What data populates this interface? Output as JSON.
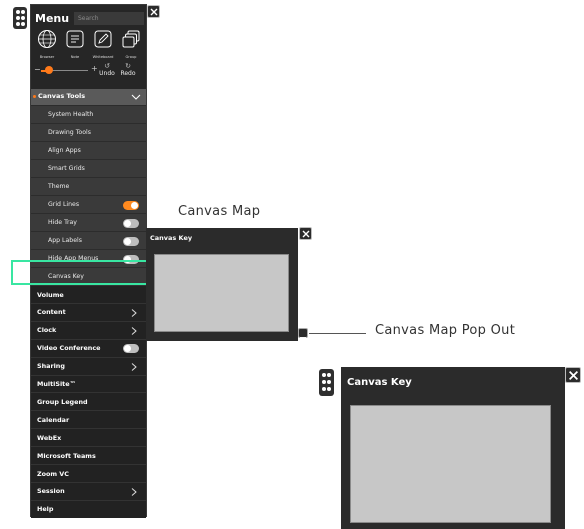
{
  "menu": {
    "title": "Menu",
    "search_placeholder": "Search",
    "tools": [
      {
        "label": "Browser",
        "icon": "globe-icon"
      },
      {
        "label": "Note",
        "icon": "note-icon"
      },
      {
        "label": "Whiteboard",
        "icon": "whiteboard-icon"
      },
      {
        "label": "Group",
        "icon": "group-icon"
      }
    ],
    "zoom": {
      "minus": "−",
      "plus": "+",
      "level": 0.18
    },
    "undo_label": "Undo",
    "redo_label": "Redo",
    "section": {
      "label": "Canvas Tools",
      "expanded": true
    },
    "sub_items": [
      {
        "label": "System Health"
      },
      {
        "label": "Drawing Tools"
      },
      {
        "label": "Align Apps"
      },
      {
        "label": "Smart Grids"
      },
      {
        "label": "Theme"
      },
      {
        "label": "Grid Lines",
        "toggle": "on"
      },
      {
        "label": "Hide Tray",
        "toggle": "off"
      },
      {
        "label": "App Labels",
        "toggle": "off"
      },
      {
        "label": "Hide App Menus",
        "toggle": "off"
      },
      {
        "label": "Canvas Key"
      }
    ],
    "items": [
      {
        "label": "Volume"
      },
      {
        "label": "Content",
        "chevron": true
      },
      {
        "label": "Clock",
        "chevron": true
      },
      {
        "label": "Video Conference",
        "toggle": "off"
      },
      {
        "label": "Sharing",
        "chevron": true
      },
      {
        "label": "MultiSite™"
      },
      {
        "label": "Group Legend"
      },
      {
        "label": "Calendar"
      },
      {
        "label": "WebEx"
      },
      {
        "label": "Microsoft Teams"
      },
      {
        "label": "Zoom VC"
      },
      {
        "label": "Session",
        "chevron": true
      },
      {
        "label": "Help"
      }
    ]
  },
  "canvas_map": {
    "caption": "Canvas Map",
    "title": "Canvas Key",
    "popout_caption": "Canvas Map Pop Out"
  },
  "popout": {
    "title": "Canvas Key"
  },
  "colors": {
    "accent": "#ff7a1a",
    "highlight": "#39e6a2",
    "panel": "#262626",
    "map": "#c7c7c7"
  }
}
